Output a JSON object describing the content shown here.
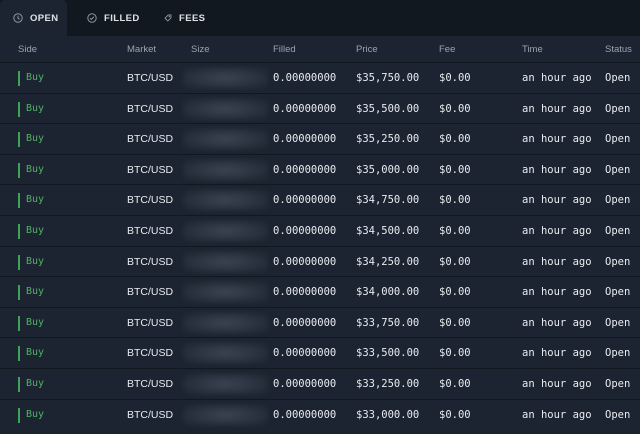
{
  "tabs": [
    {
      "label": "OPEN",
      "icon": "clock-icon",
      "active": true
    },
    {
      "label": "FILLED",
      "icon": "check-circle-icon",
      "active": false
    },
    {
      "label": "FEES",
      "icon": "fee-tag-icon",
      "active": false
    }
  ],
  "columns": {
    "side": "Side",
    "market": "Market",
    "size": "Size",
    "filled": "Filled",
    "price": "Price",
    "fee": "Fee",
    "time": "Time",
    "status": "Status"
  },
  "orders": [
    {
      "side": "Buy",
      "market": "BTC/USD",
      "filled": "0.00000000",
      "price": "$35,750.00",
      "fee": "$0.00",
      "time": "an hour ago",
      "status": "Open"
    },
    {
      "side": "Buy",
      "market": "BTC/USD",
      "filled": "0.00000000",
      "price": "$35,500.00",
      "fee": "$0.00",
      "time": "an hour ago",
      "status": "Open"
    },
    {
      "side": "Buy",
      "market": "BTC/USD",
      "filled": "0.00000000",
      "price": "$35,250.00",
      "fee": "$0.00",
      "time": "an hour ago",
      "status": "Open"
    },
    {
      "side": "Buy",
      "market": "BTC/USD",
      "filled": "0.00000000",
      "price": "$35,000.00",
      "fee": "$0.00",
      "time": "an hour ago",
      "status": "Open"
    },
    {
      "side": "Buy",
      "market": "BTC/USD",
      "filled": "0.00000000",
      "price": "$34,750.00",
      "fee": "$0.00",
      "time": "an hour ago",
      "status": "Open"
    },
    {
      "side": "Buy",
      "market": "BTC/USD",
      "filled": "0.00000000",
      "price": "$34,500.00",
      "fee": "$0.00",
      "time": "an hour ago",
      "status": "Open"
    },
    {
      "side": "Buy",
      "market": "BTC/USD",
      "filled": "0.00000000",
      "price": "$34,250.00",
      "fee": "$0.00",
      "time": "an hour ago",
      "status": "Open"
    },
    {
      "side": "Buy",
      "market": "BTC/USD",
      "filled": "0.00000000",
      "price": "$34,000.00",
      "fee": "$0.00",
      "time": "an hour ago",
      "status": "Open"
    },
    {
      "side": "Buy",
      "market": "BTC/USD",
      "filled": "0.00000000",
      "price": "$33,750.00",
      "fee": "$0.00",
      "time": "an hour ago",
      "status": "Open"
    },
    {
      "side": "Buy",
      "market": "BTC/USD",
      "filled": "0.00000000",
      "price": "$33,500.00",
      "fee": "$0.00",
      "time": "an hour ago",
      "status": "Open"
    },
    {
      "side": "Buy",
      "market": "BTC/USD",
      "filled": "0.00000000",
      "price": "$33,250.00",
      "fee": "$0.00",
      "time": "an hour ago",
      "status": "Open"
    },
    {
      "side": "Buy",
      "market": "BTC/USD",
      "filled": "0.00000000",
      "price": "$33,000.00",
      "fee": "$0.00",
      "time": "an hour ago",
      "status": "Open"
    }
  ],
  "colors": {
    "background": "#1c2431",
    "tabbar": "#111820",
    "buy": "#4fb264",
    "header_text": "#9aa3af"
  }
}
